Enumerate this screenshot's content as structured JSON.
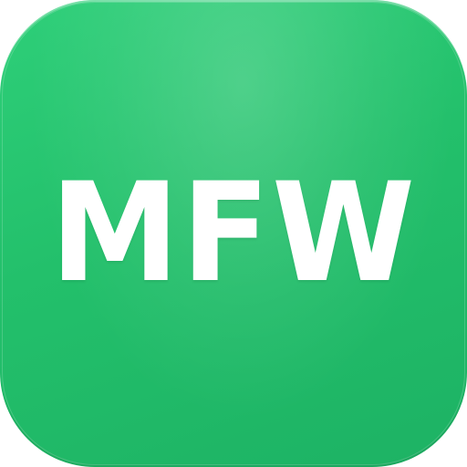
{
  "icon": {
    "monogram": "MFW",
    "background_color": "#23c06b",
    "text_color": "#ffffff"
  }
}
